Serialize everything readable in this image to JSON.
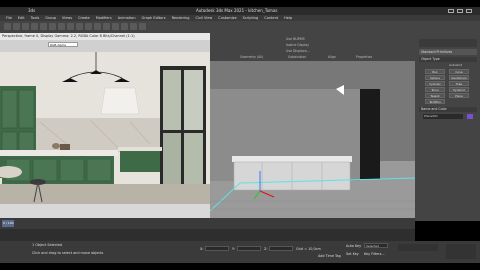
{
  "window": {
    "title_left": "3ds",
    "title_center": "Autodesk 3ds Max 2021 - kitchen_Tomas"
  },
  "menubar": [
    "File",
    "Edit",
    "Tools",
    "Group",
    "Views",
    "Create",
    "Modifiers",
    "Animation",
    "Graph Editors",
    "Rendering",
    "Civil View",
    "Customize",
    "Scripting",
    "Content",
    "Help"
  ],
  "render_window": {
    "title": "Perspective, frame 0, Display Gamma: 2.2, RGBA Color 8 Bits/Channel (1:1)",
    "dropdown": "RGB Alpha"
  },
  "ribbon": {
    "groups": [
      "Geometry (All)",
      "Subdivision",
      "Align",
      "Properties"
    ],
    "checkboxes": [
      "Use NURMS",
      "Isoline Display",
      "Use Displace..."
    ]
  },
  "command_panel": {
    "category": "Standard Primitives",
    "object_type_title": "Object Type",
    "autogrid": "AutoGrid",
    "objects": [
      "Box",
      "Cone",
      "Sphere",
      "GeoSphere",
      "Cylinder",
      "Tube",
      "Torus",
      "Pyramid",
      "Teapot",
      "Plane",
      "TextPlus"
    ],
    "name_color_title": "Name and Color",
    "name_value": "Plane001"
  },
  "timeline": {
    "frame_label": "0 / 100"
  },
  "status": {
    "selection": "1 Object Selected",
    "prompt": "Click and drag to select and move objects",
    "x_label": "X:",
    "y_label": "Y:",
    "z_label": "Z:",
    "grid": "Grid = 10,0cm",
    "add_time_tag": "Add Time Tag",
    "auto_key": "Auto Key",
    "set_key": "Set Key",
    "selected": "Selected",
    "key_filters": "Key Filters..."
  },
  "colors": {
    "cabinet_green": "#3f6a48",
    "viewport_gray": "#777777",
    "panel_bg": "#444444"
  }
}
